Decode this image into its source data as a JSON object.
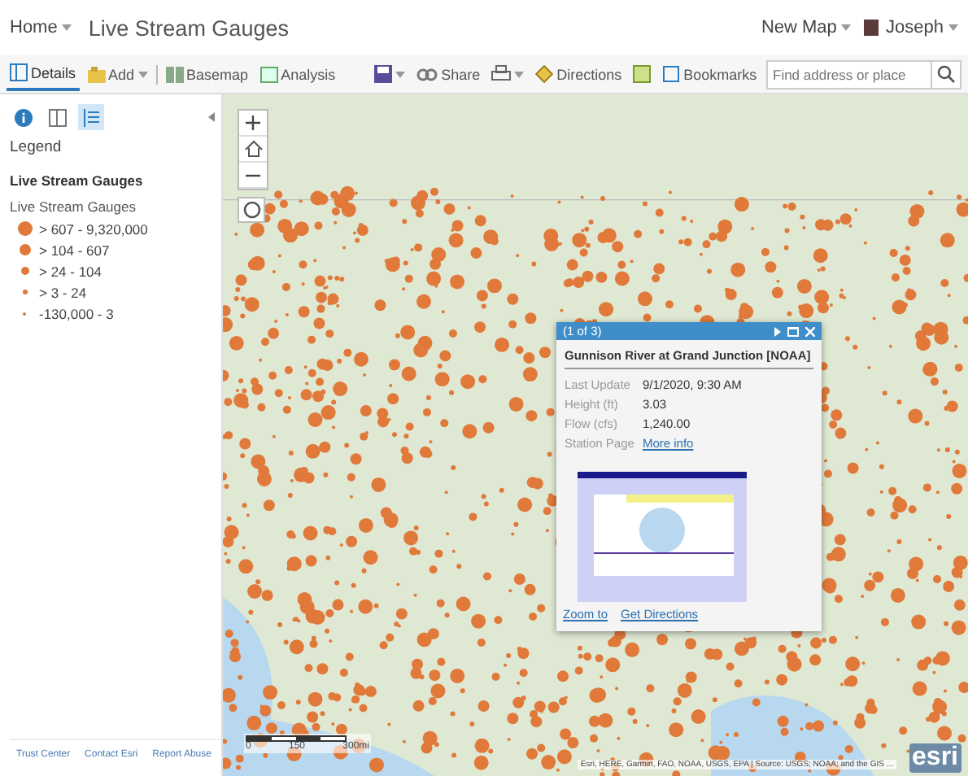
{
  "header": {
    "home": "Home",
    "title": "Live Stream Gauges",
    "new_map": "New Map",
    "user": "Joseph"
  },
  "toolbar": {
    "items": [
      {
        "kind": "tab",
        "label": "Details",
        "selected": true
      },
      {
        "kind": "menu",
        "label": "Add"
      },
      {
        "kind": "button",
        "label": "Basemap"
      },
      {
        "kind": "button",
        "label": "Analysis"
      },
      {
        "kind": "save"
      },
      {
        "kind": "button",
        "label": "Share"
      },
      {
        "kind": "print"
      },
      {
        "kind": "button",
        "label": "Directions"
      },
      {
        "kind": "measure"
      },
      {
        "kind": "button",
        "label": "Bookmarks"
      }
    ],
    "search": {
      "placeholder": "Find address or place"
    }
  },
  "sidebar": {
    "tabs": [
      {
        "kind": "about",
        "selected": false
      },
      {
        "kind": "content",
        "selected": false
      },
      {
        "kind": "legend",
        "selected": true
      }
    ],
    "heading": "Legend",
    "layer": "Live Stream Gauges",
    "sublayer": "Live Stream Gauges",
    "classes": [
      "> 607 - 9,320,000",
      "> 104 - 607",
      "> 24 - 104",
      "> 3 - 24",
      "-130,000 - 3"
    ],
    "footer": [
      "Trust Center",
      "Contact Esri",
      "Report Abuse"
    ]
  },
  "map": {
    "scale": {
      "labels": [
        "0",
        "150",
        "300mi"
      ]
    },
    "attribution": "Esri, HERE, Garmin, FAO, NOAA, USGS, EPA | Source: USGS; NOAA; and the GIS ...",
    "logo": "esri",
    "popup": {
      "counter": "(1 of 3)",
      "title": "Gunnison River at Grand Junction [NOAA]",
      "fields": [
        {
          "label": "Last Update",
          "value": "9/1/2020, 9:30 AM",
          "kind": "text"
        },
        {
          "label": "Height (ft)",
          "value": "3.03",
          "kind": "text"
        },
        {
          "label": "Flow (cfs)",
          "value": "1,240.00",
          "kind": "text"
        },
        {
          "label": "Station Page",
          "value": "More info",
          "kind": "link"
        }
      ],
      "actions": [
        "Zoom to",
        "Get Directions"
      ]
    }
  }
}
